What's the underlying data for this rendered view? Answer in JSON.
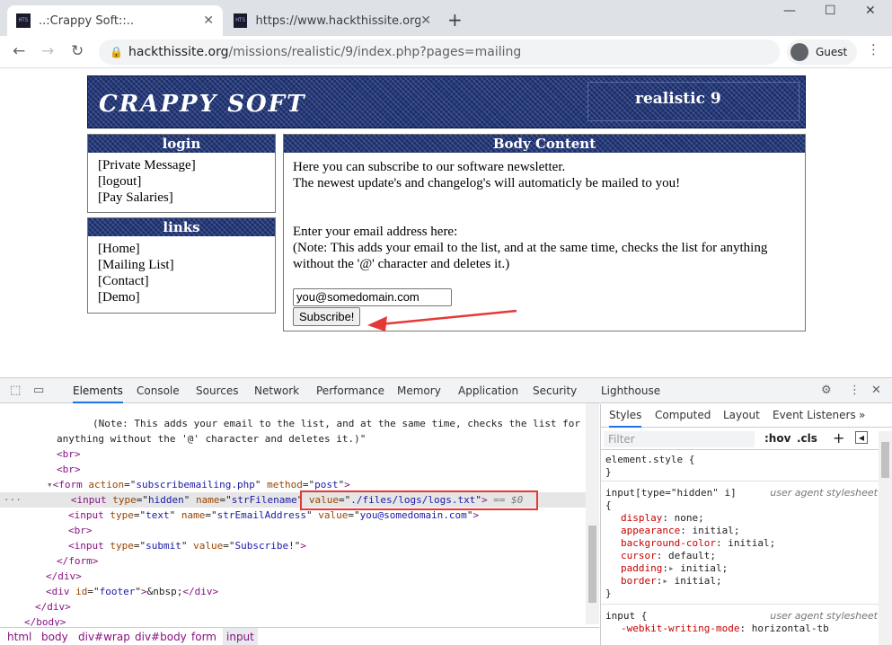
{
  "browser": {
    "tabs": [
      {
        "title": "..:Crappy Soft::..",
        "active": true
      },
      {
        "title": "https://www.hackthissite.org/m",
        "active": false
      }
    ],
    "new_tab_icon": "plus-icon",
    "url_host": "hackthissite.org",
    "url_path": "/missions/realistic/9/index.php?pages=mailing",
    "profile_label": "Guest"
  },
  "site": {
    "logo_text": "CRAPPY SOFT",
    "level_text": "realistic 9",
    "login_box": {
      "title": "login",
      "links": [
        "[Private Message]",
        "[logout]",
        "[Pay Salaries]"
      ]
    },
    "links_box": {
      "title": "links",
      "links": [
        "[Home]",
        "[Mailing List]",
        "[Contact]",
        "[Demo]"
      ]
    },
    "body_box": {
      "title": "Body Content",
      "line1": "Here you can subscribe to our software newsletter.",
      "line2": "The newest update's and changelog's will automaticly be mailed to you!",
      "line3": "Enter your email address here:",
      "line4": "(Note: This adds your email to the list, and at the same time, checks the list for anything without the '@' character and deletes it.)",
      "email_value": "you@somedomain.com",
      "submit_label": "Subscribe!"
    }
  },
  "devtools": {
    "tabs": [
      "Elements",
      "Console",
      "Sources",
      "Network",
      "Performance",
      "Memory",
      "Application",
      "Security",
      "Lighthouse"
    ],
    "selected_tab": "Elements",
    "dom_lines": {
      "note1": "(Note: This adds your email to the list, and at the same time, checks the list for",
      "note2": "anything without the '@' character and deletes it.)\"",
      "br": "<br>",
      "form_tag": "form",
      "form_action": "subscribemailing.php",
      "form_method": "post",
      "hidden_type": "hidden",
      "hidden_name": "strFilename",
      "hidden_value": "./files/logs/logs.txt",
      "selected_marker": "== $0",
      "text_type": "text",
      "text_name": "strEmailAddress",
      "text_value": "you@somedomain.com",
      "submit_type": "submit",
      "submit_value": "Subscribe!",
      "footer_id": "footer",
      "nbsp": "&nbsp;"
    },
    "breadcrumbs": [
      "html",
      "body",
      "div#wrap",
      "div#body",
      "form",
      "input"
    ],
    "styles_tabs": [
      "Styles",
      "Computed",
      "Layout",
      "Event Listeners"
    ],
    "filter_placeholder": "Filter",
    "filter_hov": ":hov",
    "filter_cls": ".cls",
    "rules": {
      "element_style": "element.style {",
      "hidden_selector": "input[type=\"hidden\" i]",
      "hidden_origin": "user agent stylesheet",
      "hidden_decls": [
        {
          "prop": "display",
          "value": "none;"
        },
        {
          "prop": "appearance",
          "value": "initial;"
        },
        {
          "prop": "background-color",
          "value": "initial;"
        },
        {
          "prop": "cursor",
          "value": "default;"
        },
        {
          "prop": "padding",
          "value": "initial;"
        },
        {
          "prop": "border",
          "value": "initial;"
        }
      ],
      "input_selector": "input {",
      "input_origin": "user agent stylesheet",
      "input_decl_prop": "-webkit-writing-mode",
      "input_decl_value": "horizontal-tb"
    }
  }
}
